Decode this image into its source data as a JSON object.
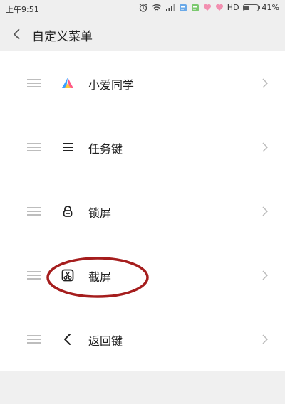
{
  "status_bar": {
    "time": "上午9:51",
    "network": "HD",
    "battery": "41%",
    "battery_level": 0.41
  },
  "header": {
    "title": "自定义菜单"
  },
  "menu_items": [
    {
      "label": "小爱同学",
      "icon": "xiaoai-icon"
    },
    {
      "label": "任务键",
      "icon": "menu-icon"
    },
    {
      "label": "锁屏",
      "icon": "lock-icon"
    },
    {
      "label": "截屏",
      "icon": "screenshot-icon"
    },
    {
      "label": "返回键",
      "icon": "back-arrow-icon"
    }
  ],
  "colors": {
    "highlight_circle": "#a51d1d",
    "xiaoai_blue": "#3aa0ff",
    "xiaoai_pink": "#ff5a8a",
    "xiaoai_yellow": "#ffc83a"
  }
}
